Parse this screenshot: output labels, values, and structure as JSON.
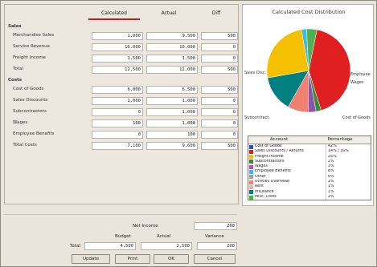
{
  "columns": [
    "Calculated",
    "Actual",
    "Diff"
  ],
  "sections": [
    {
      "title": "Sales",
      "rows": [
        {
          "label": "Merchandise Sales",
          "values": [
            "1,000",
            "9,500",
            "500"
          ]
        },
        {
          "label": "Service Revenue",
          "values": [
            "10,000",
            "10,000",
            "0"
          ]
        },
        {
          "label": "Freight Income",
          "values": [
            "1,500",
            "1,500",
            "0"
          ]
        },
        {
          "label": "Total",
          "values": [
            "12,500",
            "12,000",
            "500"
          ]
        }
      ]
    },
    {
      "title": "Costs",
      "rows": [
        {
          "label": "Cost of Goods",
          "values": [
            "6,000",
            "6,500",
            "500"
          ]
        },
        {
          "label": "Sales Discounts",
          "values": [
            "1,000",
            "1,000",
            "0"
          ]
        },
        {
          "label": "Subcontractors",
          "values": [
            "0",
            "1,000",
            "0"
          ]
        },
        {
          "label": "Wages",
          "values": [
            "100",
            "1,000",
            "0"
          ]
        },
        {
          "label": "Employee Benefits",
          "values": [
            "0",
            "100",
            "0"
          ]
        },
        {
          "label": "Total Costs",
          "values": [
            "7,100",
            "9,600",
            "500"
          ]
        }
      ]
    }
  ],
  "summary": {
    "net_label": "Net Income",
    "net_value": "200",
    "sub_labels": [
      "Budget",
      "Actual",
      "Variance"
    ],
    "total_label": "Total",
    "total_values": [
      "4,500",
      "2,500",
      "200"
    ]
  },
  "buttons": [
    "Update",
    "Print",
    "OK",
    "Cancel"
  ],
  "chart": {
    "title": "Calculated Cost Distribution",
    "legend_headers": [
      "Account",
      "Percentage"
    ],
    "pie_labels": [
      "Sales Disc.",
      "Employee",
      "Wages",
      "Subcontract.",
      "Cost of Goods"
    ]
  },
  "chart_data": {
    "type": "pie",
    "title": "Calculated Cost Distribution",
    "slices": [
      {
        "name": "Cost of Goods",
        "value": 42,
        "color": "#e02020"
      },
      {
        "name": "Subcontractors",
        "value": 2,
        "color": "#3a8a3a"
      },
      {
        "name": "Wages",
        "value": 3,
        "color": "#8855aa"
      },
      {
        "name": "Employee Benefits",
        "value": 8,
        "color": "#f08070"
      },
      {
        "name": "Sales Discounts",
        "value": 14,
        "color": "#008080"
      },
      {
        "name": "Freight",
        "value": 25,
        "color": "#f5c000"
      },
      {
        "name": "Other Costs",
        "value": 2,
        "color": "#40b8e0"
      },
      {
        "name": "Misc",
        "value": 4,
        "color": "#50b050"
      }
    ]
  },
  "legend": [
    {
      "name": "Cost of Goods",
      "value": "42%",
      "color": "#3050c0"
    },
    {
      "name": "Sales Discounts / Returns",
      "value": "14% / 30%",
      "color": "#e02020"
    },
    {
      "name": "Freight Income",
      "value": "25%",
      "color": "#f5c000"
    },
    {
      "name": "Subcontractors",
      "value": "2%",
      "color": "#3a8a3a"
    },
    {
      "name": "Wages",
      "value": "3%",
      "color": "#b050c0"
    },
    {
      "name": "Employee Benefits",
      "value": "8%",
      "color": "#40b8e0"
    },
    {
      "name": "Other",
      "value": "0%",
      "color": "#a0a0a0"
    },
    {
      "name": "Utilities Overhead",
      "value": "2%",
      "color": "#f08070"
    },
    {
      "name": "Rent",
      "value": "1%",
      "color": "#f0b0a0"
    },
    {
      "name": "Insurance",
      "value": "1%",
      "color": "#008080"
    },
    {
      "name": "Misc. Costs",
      "value": "2%",
      "color": "#50b050"
    }
  ]
}
